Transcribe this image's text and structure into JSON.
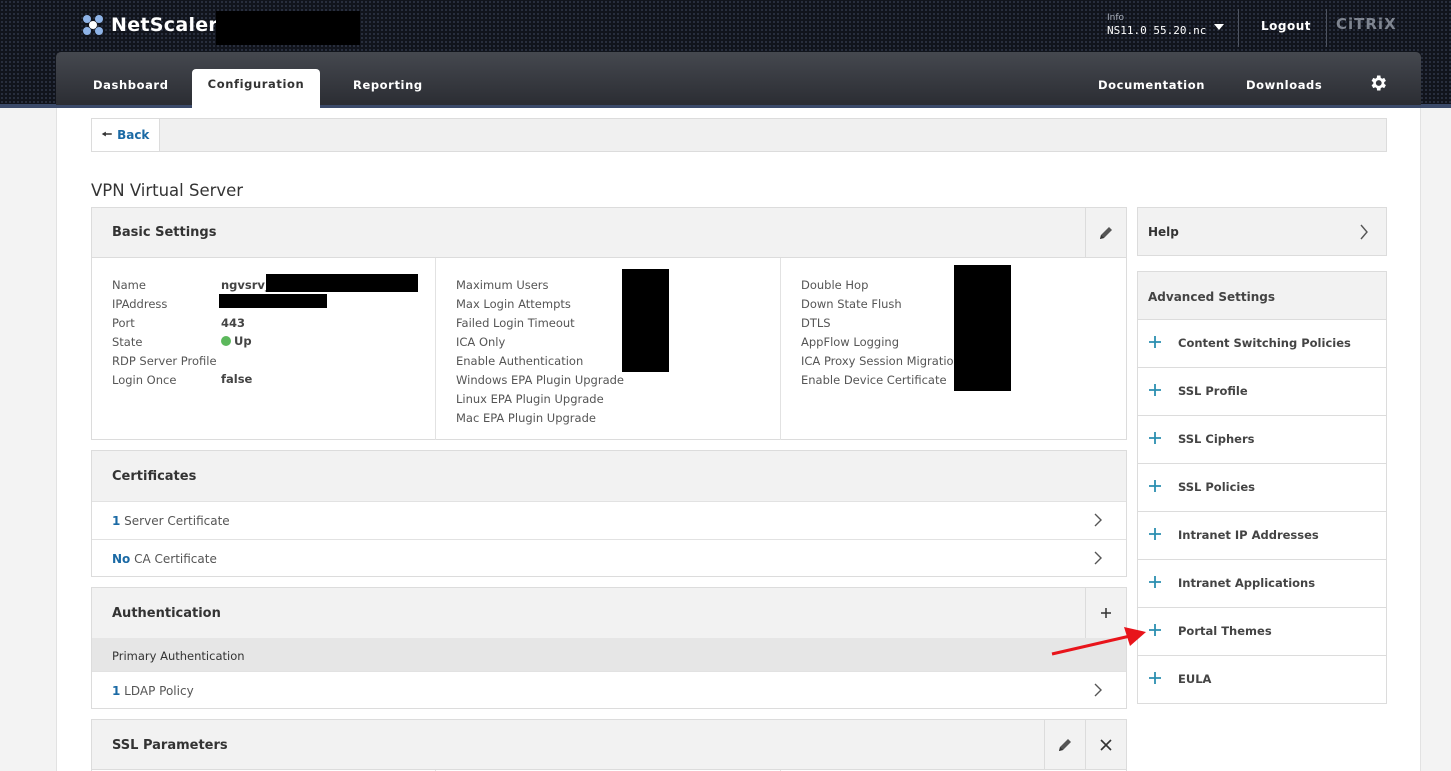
{
  "header": {
    "brand": "NetScaler",
    "info_label": "Info",
    "version": "NS11.0 55.20.nc",
    "logout_label": "Logout",
    "vendor": "CiTRiX"
  },
  "nav": {
    "tabs": [
      {
        "label": "Dashboard"
      },
      {
        "label": "Configuration",
        "active": true
      },
      {
        "label": "Reporting"
      }
    ],
    "documentation_label": "Documentation",
    "downloads_label": "Downloads"
  },
  "back_label": "Back",
  "page_title": "VPN Virtual Server",
  "basic_settings": {
    "title": "Basic Settings",
    "col1": [
      {
        "label": "Name",
        "value": "ngvsrv_"
      },
      {
        "label": "IPAddress",
        "value": ""
      },
      {
        "label": "Port",
        "value": "443"
      },
      {
        "label": "State",
        "value": "Up"
      },
      {
        "label": "RDP Server Profile",
        "value": ""
      },
      {
        "label": "Login Once",
        "value": "false"
      }
    ],
    "col2": [
      {
        "label": "Maximum Users"
      },
      {
        "label": "Max Login Attempts"
      },
      {
        "label": "Failed Login Timeout"
      },
      {
        "label": "ICA Only"
      },
      {
        "label": "Enable Authentication"
      },
      {
        "label": "Windows EPA Plugin Upgrade"
      },
      {
        "label": "Linux EPA Plugin Upgrade"
      },
      {
        "label": "Mac EPA Plugin Upgrade"
      }
    ],
    "col3": [
      {
        "label": "Double Hop"
      },
      {
        "label": "Down State Flush"
      },
      {
        "label": "DTLS"
      },
      {
        "label": "AppFlow Logging"
      },
      {
        "label": "ICA Proxy Session Migration"
      },
      {
        "label": "Enable Device Certificate"
      }
    ],
    "state_color": "#5cb85c"
  },
  "certificates": {
    "title": "Certificates",
    "rows": [
      {
        "count": "1",
        "label": " Server Certificate"
      },
      {
        "count": "No",
        "label": " CA Certificate"
      }
    ]
  },
  "authentication": {
    "title": "Authentication",
    "subheader": "Primary Authentication",
    "rows": [
      {
        "count": "1",
        "label": " LDAP Policy"
      }
    ]
  },
  "ssl_parameters": {
    "title": "SSL Parameters"
  },
  "help_label": "Help",
  "advanced_settings": {
    "title": "Advanced Settings",
    "items": [
      {
        "label": "Content Switching Policies"
      },
      {
        "label": "SSL Profile"
      },
      {
        "label": "SSL Ciphers"
      },
      {
        "label": "SSL Policies"
      },
      {
        "label": "Intranet IP Addresses"
      },
      {
        "label": "Intranet Applications"
      },
      {
        "label": "Portal Themes"
      },
      {
        "label": "EULA"
      }
    ]
  },
  "colors": {
    "link_blue": "#1b6aa5",
    "plus_teal": "#2b8fb0",
    "annotation_red": "#e8141b"
  }
}
